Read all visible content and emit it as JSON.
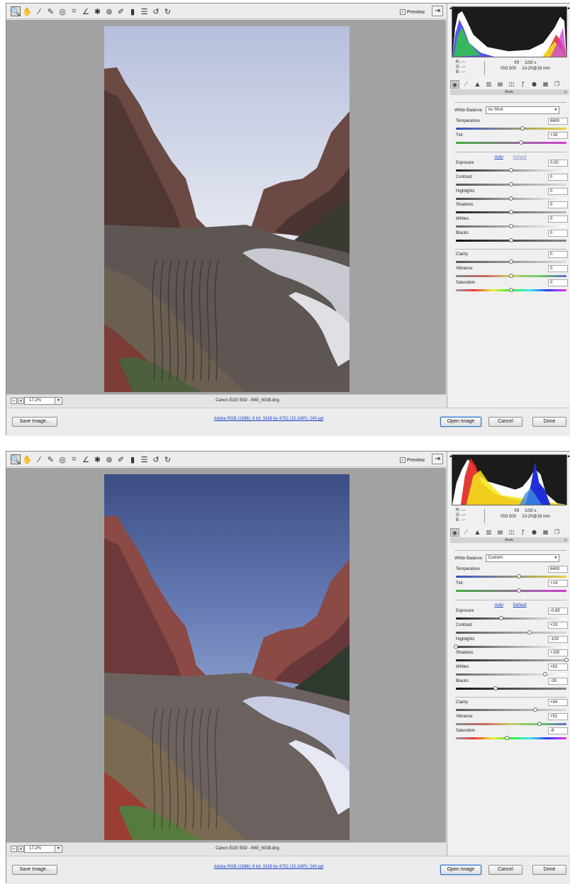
{
  "toolbar": {
    "tools": [
      "zoom-icon",
      "hand-icon",
      "white-balance-icon",
      "color-sampler-icon",
      "targeted-adjustment-icon",
      "crop-icon",
      "straighten-icon",
      "spot-removal-icon",
      "red-eye-icon",
      "adjustment-brush-icon",
      "graduated-filter-icon",
      "preferences-icon",
      "rotate-ccw-icon",
      "rotate-cw-icon"
    ],
    "preview_label": "Preview"
  },
  "colors": {
    "link": "#1e3fc6",
    "default_button_border": "#3a78c4",
    "canvas": "#a2a2a2"
  },
  "windows": [
    {
      "id": "before",
      "zoom": "17.2%",
      "filename": "Canon EOS 50D  -  IMG_6338.dng",
      "save_label": "Save Image...",
      "workflow_info": "Adobe RGB (1998); 8 bit; 3168 by 4752 (15.1MP); 240 ppi",
      "open_label": "Open Image",
      "cancel_label": "Cancel",
      "done_label": "Done",
      "readout": {
        "r": "R:   ---",
        "g": "G:   ---",
        "b": "B:   ---",
        "aperture": "f/9",
        "shutter": "1/30 s",
        "iso": "ISO 500",
        "lens": "10-20@18 mm"
      },
      "panel_title": "Basic",
      "auto_label": "Auto",
      "default_label": "Default",
      "wb_label": "White Balance:",
      "wb_value": "As Shot",
      "sliders": {
        "temperature": {
          "label": "Temperature",
          "value": "6600",
          "pos": 0.6
        },
        "tint": {
          "label": "Tint",
          "value": "+18",
          "pos": 0.59
        },
        "exposure": {
          "label": "Exposure",
          "value": "0.00",
          "pos": 0.5
        },
        "contrast": {
          "label": "Contrast",
          "value": "0",
          "pos": 0.5
        },
        "highlights": {
          "label": "Highlights",
          "value": "0",
          "pos": 0.5
        },
        "shadows": {
          "label": "Shadows",
          "value": "0",
          "pos": 0.5
        },
        "whites": {
          "label": "Whites",
          "value": "0",
          "pos": 0.5
        },
        "blacks": {
          "label": "Blacks",
          "value": "0",
          "pos": 0.5
        },
        "clarity": {
          "label": "Clarity",
          "value": "0",
          "pos": 0.5
        },
        "vibrance": {
          "label": "Vibrance",
          "value": "0",
          "pos": 0.5
        },
        "saturation": {
          "label": "Saturation",
          "value": "0",
          "pos": 0.5
        }
      }
    },
    {
      "id": "after",
      "zoom": "17.2%",
      "filename": "Canon EOS 50D  -  IMG_6338.dng",
      "save_label": "Save Image...",
      "workflow_info": "Adobe RGB (1998); 8 bit; 3168 by 4752 (15.1MP); 240 ppi",
      "open_label": "Open Image",
      "cancel_label": "Cancel",
      "done_label": "Done",
      "readout": {
        "r": "R:   ---",
        "g": "G:   ---",
        "b": "B:   ---",
        "aperture": "f/9",
        "shutter": "1/30 s",
        "iso": "ISO 500",
        "lens": "10-20@18 mm"
      },
      "panel_title": "Basic",
      "auto_label": "Auto",
      "default_label": "Default",
      "wb_label": "White Balance:",
      "wb_value": "Custom",
      "sliders": {
        "temperature": {
          "label": "Temperature",
          "value": "6400",
          "pos": 0.57
        },
        "tint": {
          "label": "Tint",
          "value": "+14",
          "pos": 0.57
        },
        "exposure": {
          "label": "Exposure",
          "value": "-0.85",
          "pos": 0.41
        },
        "contrast": {
          "label": "Contrast",
          "value": "+33",
          "pos": 0.665
        },
        "highlights": {
          "label": "Highlights",
          "value": "-100",
          "pos": 0.0
        },
        "shadows": {
          "label": "Shadows",
          "value": "+100",
          "pos": 1.0
        },
        "whites": {
          "label": "Whites",
          "value": "+62",
          "pos": 0.81
        },
        "blacks": {
          "label": "Blacks",
          "value": "-28",
          "pos": 0.36
        },
        "clarity": {
          "label": "Clarity",
          "value": "+44",
          "pos": 0.72
        },
        "vibrance": {
          "label": "Vibrance",
          "value": "+51",
          "pos": 0.755
        },
        "saturation": {
          "label": "Saturation",
          "value": "-8",
          "pos": 0.46
        }
      }
    }
  ]
}
